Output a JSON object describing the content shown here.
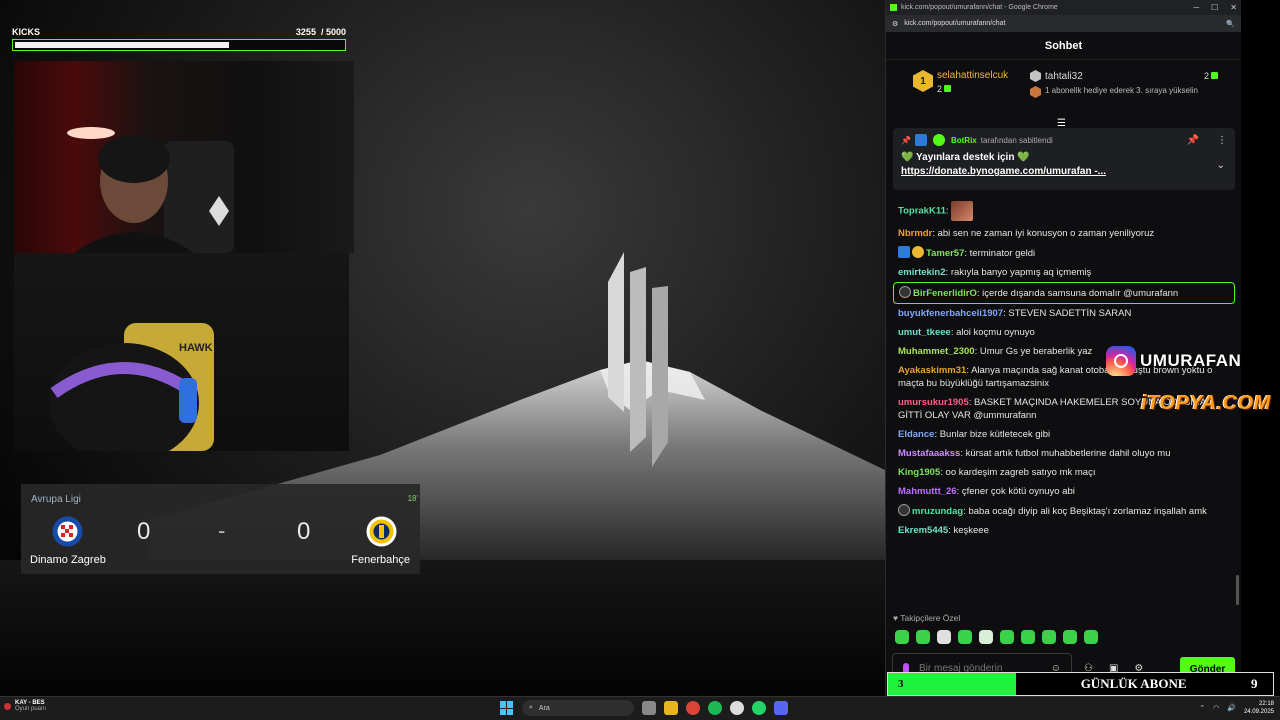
{
  "kicks": {
    "title": "KICKS",
    "current": "3255",
    "goal": "/ 5000",
    "progress": 0.651
  },
  "scoreboard": {
    "league": "Avrupa Ligi",
    "minute": "18'",
    "home_team": "Dinamo Zagreb",
    "away_team": "Fenerbahçe",
    "home_score": "0",
    "separator": "-",
    "away_score": "0"
  },
  "browser": {
    "title": "kick.com/popout/umurafann/chat - Google Chrome",
    "url": "kick.com/popout/umurafann/chat"
  },
  "chat": {
    "header": "Sohbet",
    "top_gifter": {
      "rank": "1",
      "name": "selahattinselcuk",
      "count": "2"
    },
    "second_gifter": {
      "name": "tahtali32",
      "count": "2",
      "hint": "1 abonelik hediye ederek 3. sıraya yükselin"
    },
    "pinned": {
      "by_user": "BotRix",
      "by_text": "tarafından sabitlendi",
      "line": "💚 Yayınlara destek için 💚",
      "link": "https://donate.bynogame.com/umurafan -..."
    },
    "messages": [
      {
        "user": "ToprakK11",
        "color": "#53e0a0",
        "text": "",
        "emote": true
      },
      {
        "user": "Nbrmdr",
        "color": "#f0a030",
        "text": "abi sen ne zaman iyi konusyon o zaman yeniliyoruz"
      },
      {
        "user": "Tamer57",
        "color": "#7be35a",
        "text": "terminator geldi",
        "badges": [
          "blue",
          "gold"
        ]
      },
      {
        "user": "emirtekin2",
        "color": "#6fe2c8",
        "text": "rakıyla banyo yapmış aq içmemiş"
      },
      {
        "user": "BirFenerlidirO",
        "color": "#7be35a",
        "text": "içerde dışarıda samsuna domalır @umurafann",
        "highlight": true,
        "badges": [
          "circle"
        ]
      },
      {
        "user": "buyukfenerbahceli1907",
        "color": "#7fa8ff",
        "text": "STEVEN SADETTİN SARAN"
      },
      {
        "user": "umut_tkeee",
        "color": "#6fe2c8",
        "text": "aloi koçmu oynuyo"
      },
      {
        "user": "Muhammet_2300",
        "color": "#a6e35a",
        "text": "Umur Gs ye beraberlik yaz"
      },
      {
        "user": "Ayakaskimm31",
        "color": "#f0a030",
        "text": "Alanya maçında sağ kanat otoban olmuştu brown yoktu o maçta bu büyüklüğü tartışamazsinix"
      },
      {
        "user": "umursukur1905",
        "color": "#ff5e8a",
        "text": "BASKET MAÇINDA HAKEMELER SOYUNA ODASINA GİTTİ OLAY VAR @ummurafann"
      },
      {
        "user": "Eldance",
        "color": "#7fa8ff",
        "text": "Bunlar bize kütletecek gibi"
      },
      {
        "user": "Mustafaaakss",
        "color": "#d08aff",
        "text": "kürsat artık futbol muhabbetlerine dahil oluyo mu"
      },
      {
        "user": "King1905",
        "color": "#7be35a",
        "text": "oo kardeşim zagreb satıyo mk maçı"
      },
      {
        "user": "Mahmuttt_26",
        "color": "#c070ff",
        "text": "çfener çok kötü oynuyo abi"
      },
      {
        "user": "mruzundag",
        "color": "#53e0a0",
        "text": "baba ocağı diyip ali koç Beşiktaş'ı zorlamaz inşallah amk",
        "badges": [
          "circle"
        ]
      },
      {
        "user": "Ekrem5445",
        "color": "#6fe2c8",
        "text": "keşkeee"
      }
    ],
    "followers_only": "Takipçilere Özel",
    "composer_placeholder": "Bir mesaj gönderin",
    "send_label": "Gönder"
  },
  "overlay": {
    "instagram_handle": "UMURAFAN",
    "watermark": "iTOPYA.COM",
    "sub_goal": {
      "current": "3",
      "label": "GÜNLÜK ABONE",
      "target": "9",
      "progress": 0.333
    }
  },
  "taskbar": {
    "notify_title": "KAY - BES",
    "notify_sub": "Oyun puanı",
    "search_placeholder": "Ara",
    "time": "22:18",
    "date": "24.09.2025"
  },
  "colors": {
    "kick_green": "#53fc18",
    "gold": "#e9b730"
  }
}
